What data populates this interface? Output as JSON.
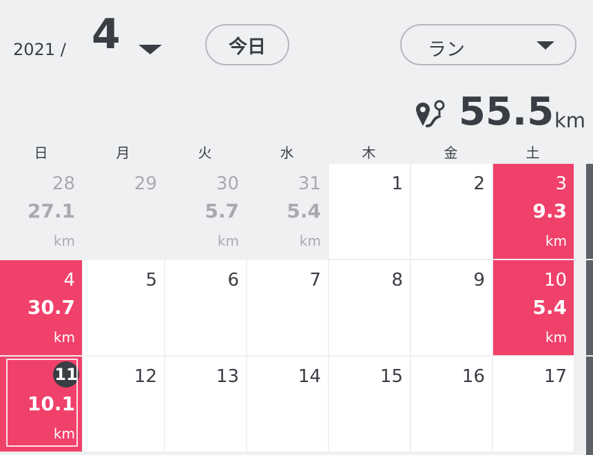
{
  "header": {
    "year": "2021 /",
    "month": "4",
    "today_button": "今日",
    "type_select": "ラン"
  },
  "summary": {
    "total_distance": "55.5",
    "unit": "km",
    "icon": "route-pin-icon"
  },
  "weekdays": [
    "日",
    "月",
    "火",
    "水",
    "木",
    "金",
    "土"
  ],
  "weeks": [
    [
      {
        "day": "28",
        "distance": "27.1",
        "unit": "km",
        "state": "other"
      },
      {
        "day": "29",
        "distance": "",
        "unit": "",
        "state": "other"
      },
      {
        "day": "30",
        "distance": "5.7",
        "unit": "km",
        "state": "other"
      },
      {
        "day": "31",
        "distance": "5.4",
        "unit": "km",
        "state": "other"
      },
      {
        "day": "1",
        "distance": "",
        "unit": "",
        "state": "normal"
      },
      {
        "day": "2",
        "distance": "",
        "unit": "",
        "state": "normal"
      },
      {
        "day": "3",
        "distance": "9.3",
        "unit": "km",
        "state": "active"
      }
    ],
    [
      {
        "day": "4",
        "distance": "30.7",
        "unit": "km",
        "state": "active"
      },
      {
        "day": "5",
        "distance": "",
        "unit": "",
        "state": "normal"
      },
      {
        "day": "6",
        "distance": "",
        "unit": "",
        "state": "normal"
      },
      {
        "day": "7",
        "distance": "",
        "unit": "",
        "state": "normal"
      },
      {
        "day": "8",
        "distance": "",
        "unit": "",
        "state": "normal"
      },
      {
        "day": "9",
        "distance": "",
        "unit": "",
        "state": "normal"
      },
      {
        "day": "10",
        "distance": "5.4",
        "unit": "km",
        "state": "active"
      }
    ],
    [
      {
        "day": "11",
        "distance": "10.1",
        "unit": "km",
        "state": "active",
        "today": true
      },
      {
        "day": "12",
        "distance": "",
        "unit": "",
        "state": "normal"
      },
      {
        "day": "13",
        "distance": "",
        "unit": "",
        "state": "normal"
      },
      {
        "day": "14",
        "distance": "",
        "unit": "",
        "state": "normal"
      },
      {
        "day": "15",
        "distance": "",
        "unit": "",
        "state": "normal"
      },
      {
        "day": "16",
        "distance": "",
        "unit": "",
        "state": "normal"
      },
      {
        "day": "17",
        "distance": "",
        "unit": "",
        "state": "normal"
      }
    ]
  ],
  "colors": {
    "background": "#eff0f2",
    "active": "#f0416a",
    "text": "#3a3d44",
    "muted": "#a8aaae"
  }
}
